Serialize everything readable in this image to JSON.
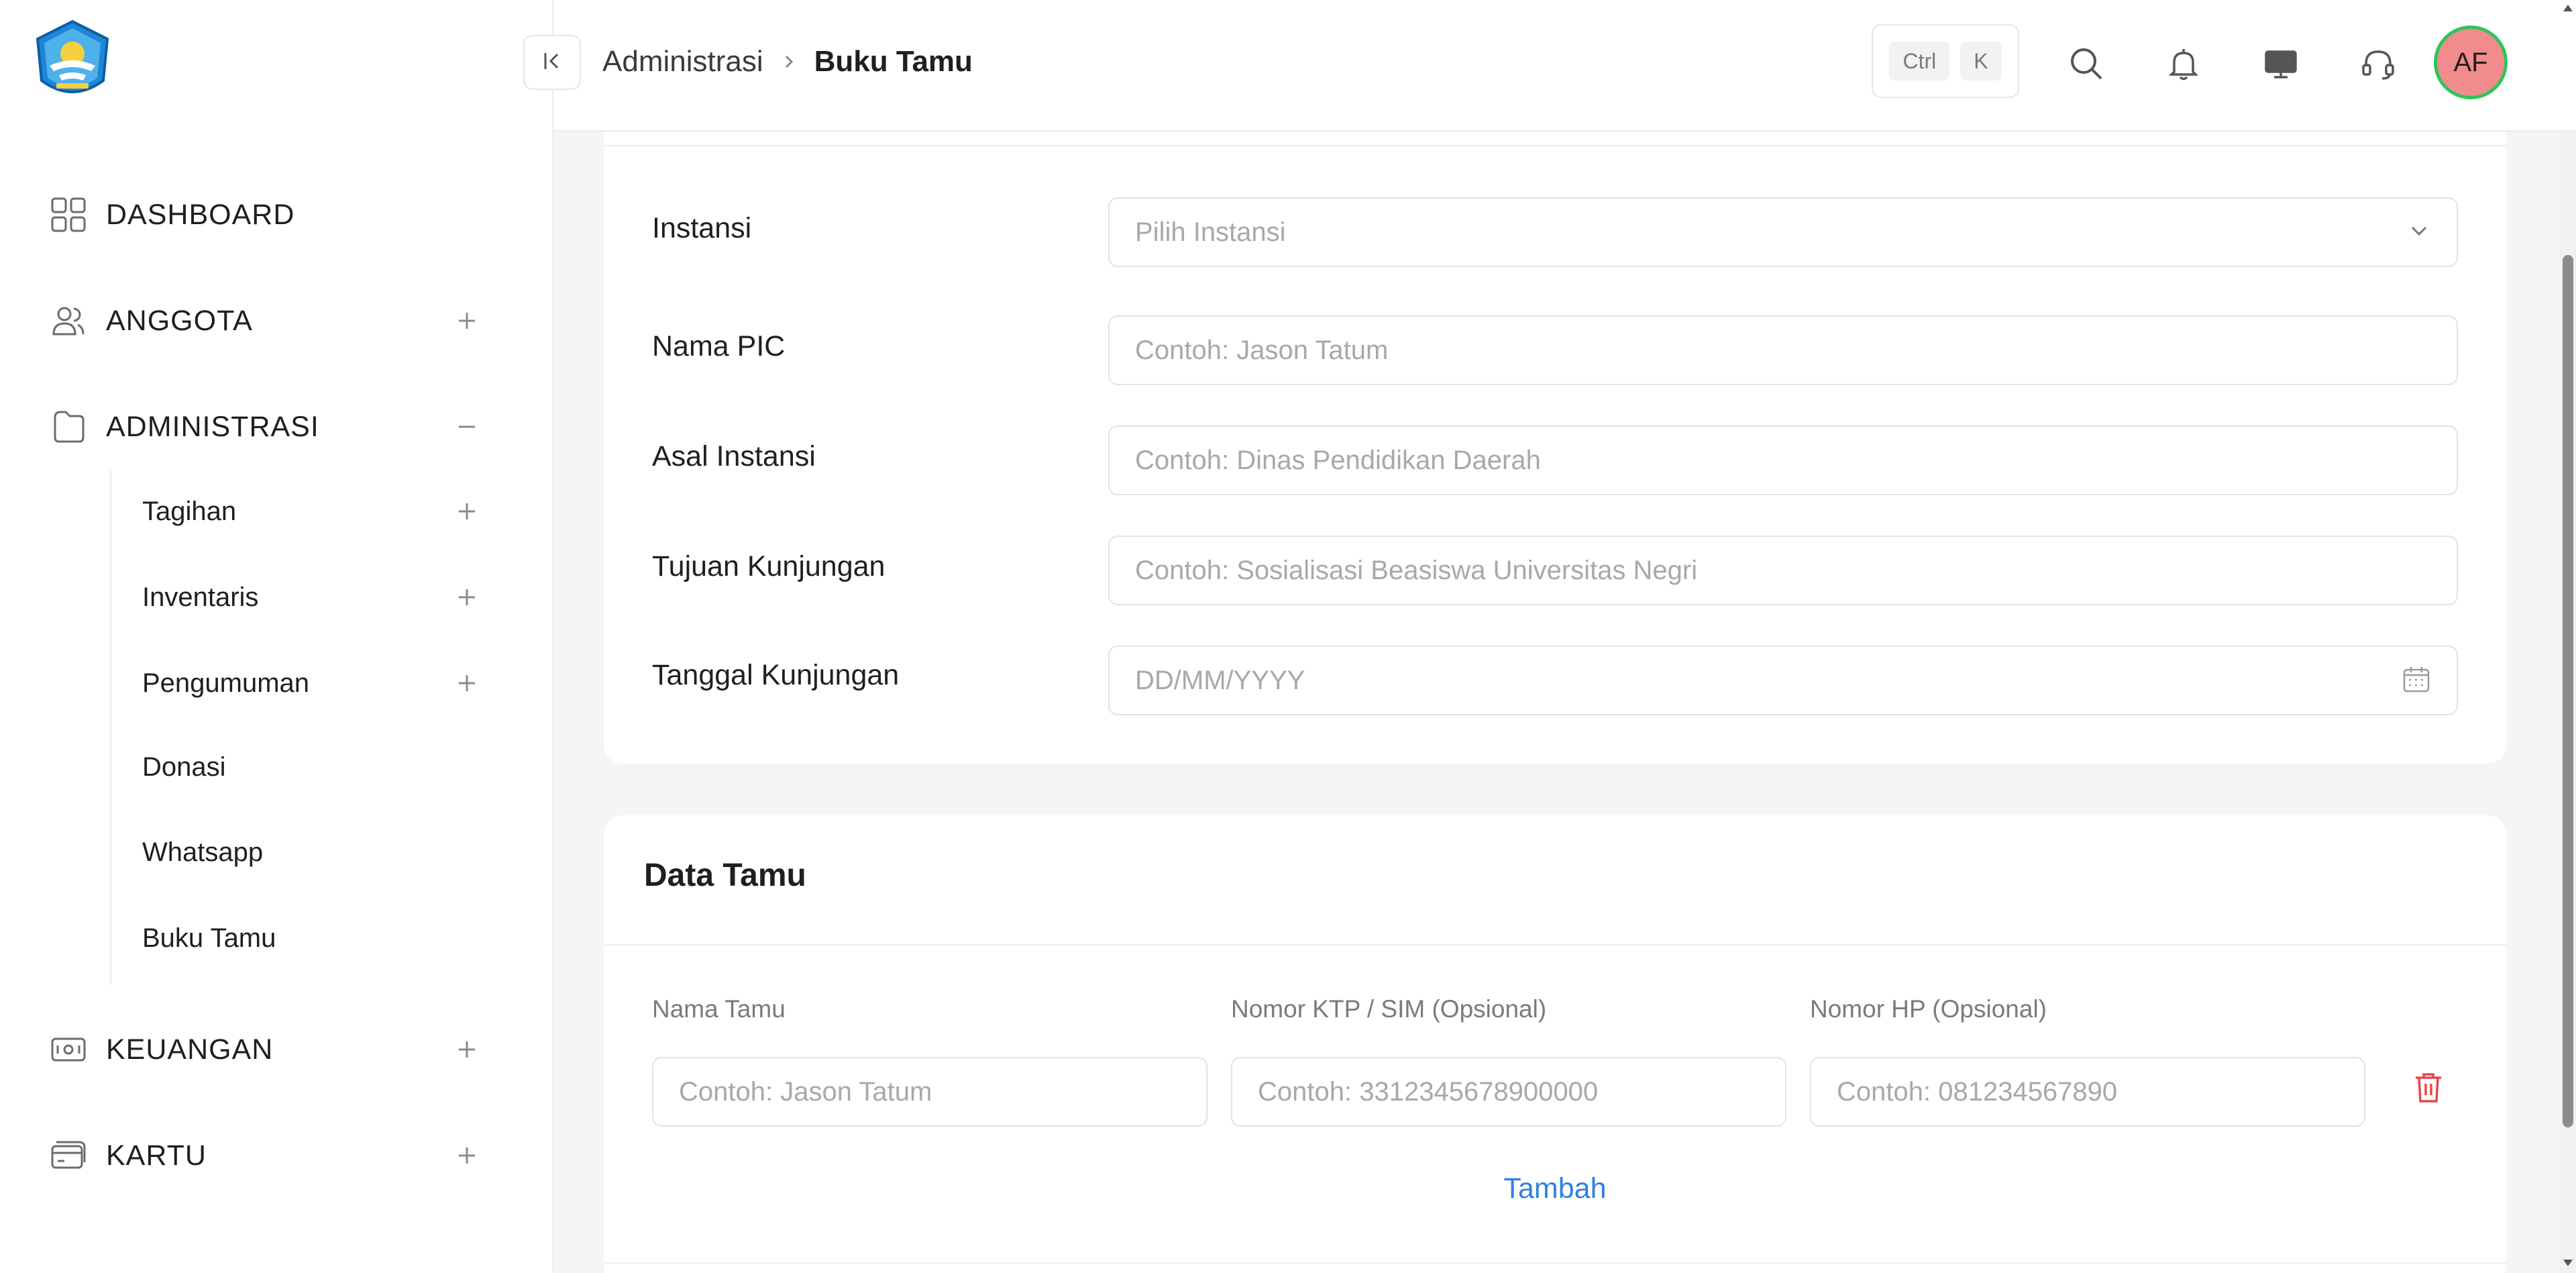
{
  "sidebar": {
    "logo": "tut-wuri-handayani-logo",
    "items": [
      {
        "label": "DASHBOARD",
        "icon": "grid-icon"
      },
      {
        "label": "ANGGOTA",
        "icon": "users-icon",
        "toggle": "+"
      },
      {
        "label": "ADMINISTRASI",
        "icon": "folder-icon",
        "toggle": "−"
      },
      {
        "label": "KEUANGAN",
        "icon": "money-icon",
        "toggle": "+"
      },
      {
        "label": "KARTU",
        "icon": "card-icon",
        "toggle": "+"
      }
    ],
    "subitems": [
      {
        "label": "Tagihan",
        "toggle": "+"
      },
      {
        "label": "Inventaris",
        "toggle": "+"
      },
      {
        "label": "Pengumuman",
        "toggle": "+"
      },
      {
        "label": "Donasi"
      },
      {
        "label": "Whatsapp"
      },
      {
        "label": "Buku Tamu"
      }
    ]
  },
  "header": {
    "breadcrumb": {
      "parent": "Administrasi",
      "current": "Buku Tamu"
    },
    "shortcut": {
      "key1": "Ctrl",
      "key2": "K"
    },
    "icons": [
      "search-icon",
      "bell-icon",
      "monitor-icon",
      "headset-icon"
    ],
    "avatar": {
      "initials": "AF",
      "bg": "#f28b8b",
      "ring": "#2fc45b"
    }
  },
  "form": {
    "fields": [
      {
        "label": "Instansi",
        "placeholder": "Pilih Instansi",
        "type": "select"
      },
      {
        "label": "Nama PIC",
        "placeholder": "Contoh: Jason Tatum",
        "type": "text"
      },
      {
        "label": "Asal Instansi",
        "placeholder": "Contoh: Dinas Pendidikan Daerah",
        "type": "text"
      },
      {
        "label": "Tujuan Kunjungan",
        "placeholder": "Contoh: Sosialisasi Beasiswa Universitas Negri",
        "type": "text"
      },
      {
        "label": "Tanggal Kunjungan",
        "placeholder": "DD/MM/YYYY",
        "type": "date"
      }
    ]
  },
  "guests": {
    "title": "Data Tamu",
    "columns": [
      {
        "label": "Nama Tamu",
        "placeholder": "Contoh: Jason Tatum"
      },
      {
        "label": "Nomor KTP / SIM (Opsional)",
        "placeholder": "Contoh: 3312345678900000"
      },
      {
        "label": "Nomor HP (Opsional)",
        "placeholder": "Contoh: 081234567890"
      }
    ],
    "add_label": "Tambah",
    "accent": "#2f7fe0",
    "delete_color": "#e5484d"
  }
}
